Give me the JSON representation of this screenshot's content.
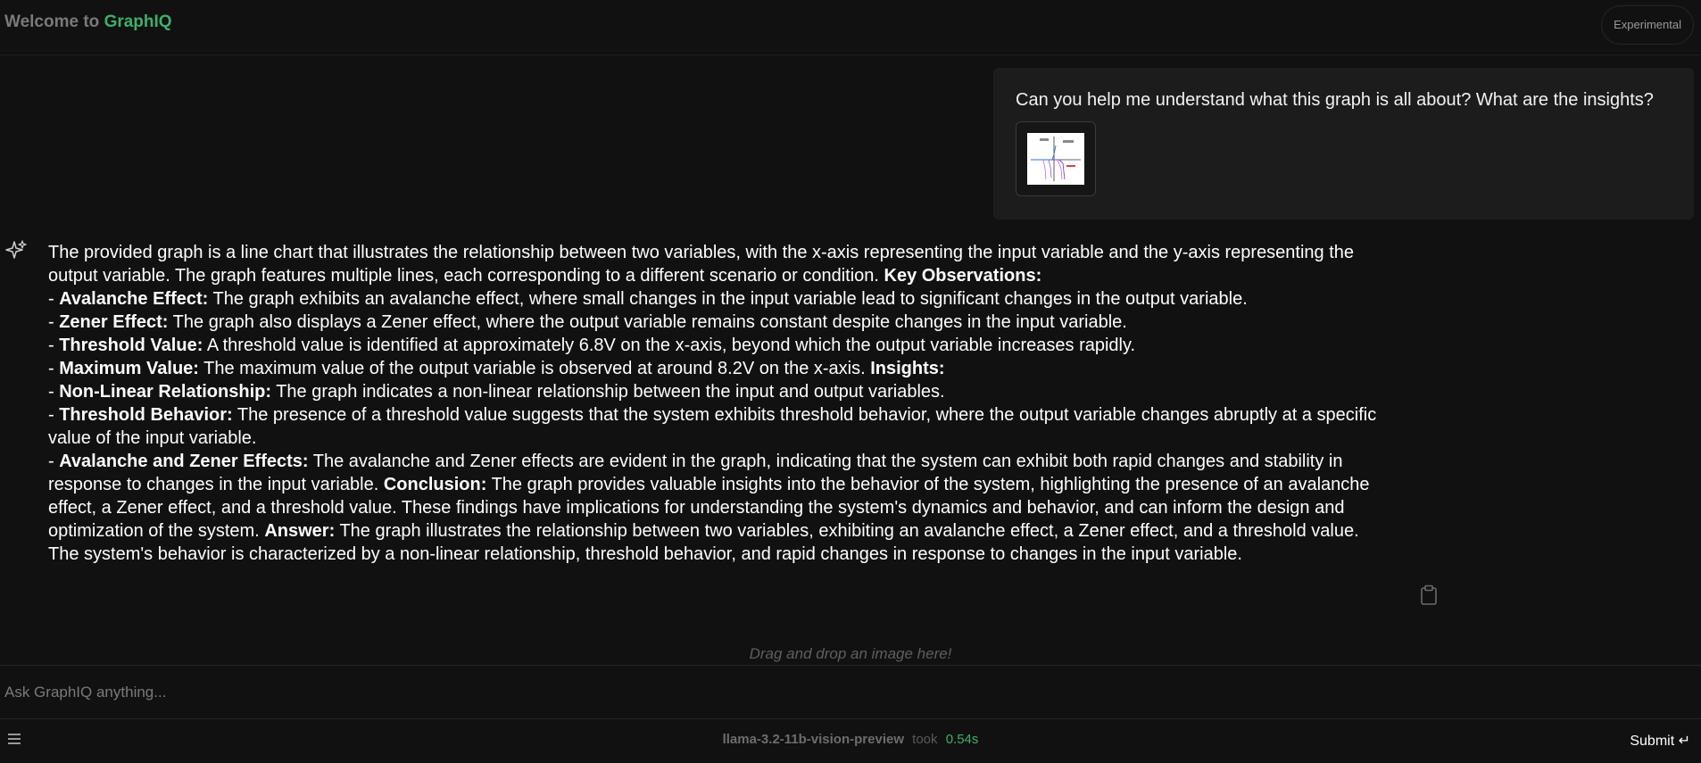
{
  "header": {
    "brand_prefix": "Welcome to",
    "brand_name": "GraphIQ",
    "badge": "Experimental"
  },
  "colors": {
    "background": "#111111",
    "accent": "#3fae6a",
    "bubble": "#1c1c1c"
  },
  "user_message": {
    "text": "Can you help me understand what this graph is all about? What are the insights?",
    "attachment_icon": "graph-thumbnail"
  },
  "assistant_message": {
    "icon": "sparkle-icon",
    "intro": "The provided graph is a line chart that illustrates the relationship between two variables, with the x-axis representing the input variable and the y-axis representing the output variable. The graph features multiple lines, each corresponding to a different scenario or condition.",
    "key_observations_heading": "Key Observations:",
    "observations": [
      {
        "term": "Avalanche Effect:",
        "text": "The graph exhibits an avalanche effect, where small changes in the input variable lead to significant changes in the output variable."
      },
      {
        "term": "Zener Effect:",
        "text": "The graph also displays a Zener effect, where the output variable remains constant despite changes in the input variable."
      },
      {
        "term": "Threshold Value:",
        "text": "A threshold value is identified at approximately 6.8V on the x-axis, beyond which the output variable increases rapidly."
      },
      {
        "term": "Maximum Value:",
        "text": "The maximum value of the output variable is observed at around 8.2V on the x-axis."
      }
    ],
    "insights_heading": "Insights:",
    "insights": [
      {
        "term": "Non-Linear Relationship:",
        "text": "The graph indicates a non-linear relationship between the input and output variables."
      },
      {
        "term": "Threshold Behavior:",
        "text": "The presence of a threshold value suggests that the system exhibits threshold behavior, where the output variable changes abruptly at a specific value of the input variable."
      },
      {
        "term": "Avalanche and Zener Effects:",
        "text": "The avalanche and Zener effects are evident in the graph, indicating that the system can exhibit both rapid changes and stability in response to changes in the input variable."
      }
    ],
    "conclusion_heading": "Conclusion:",
    "conclusion": "The graph provides valuable insights into the behavior of the system, highlighting the presence of an avalanche effect, a Zener effect, and a threshold value. These findings have implications for understanding the system's dynamics and behavior, and can inform the design and optimization of the system.",
    "answer_heading": "Answer:",
    "answer": "The graph illustrates the relationship between two variables, exhibiting an avalanche effect, a Zener effect, and a threshold value. The system's behavior is characterized by a non-linear relationship, threshold behavior, and rapid changes in response to changes in the input variable.",
    "copy_icon": "clipboard-icon"
  },
  "composer": {
    "drop_hint": "Drag and drop an image here!",
    "placeholder": "Ask GraphIQ anything..."
  },
  "footer": {
    "menu_icon": "menu-icon",
    "model": "llama-3.2-11b-vision-preview",
    "took_label": "took",
    "took_value": "0.54s",
    "submit_label": "Submit ↵"
  }
}
